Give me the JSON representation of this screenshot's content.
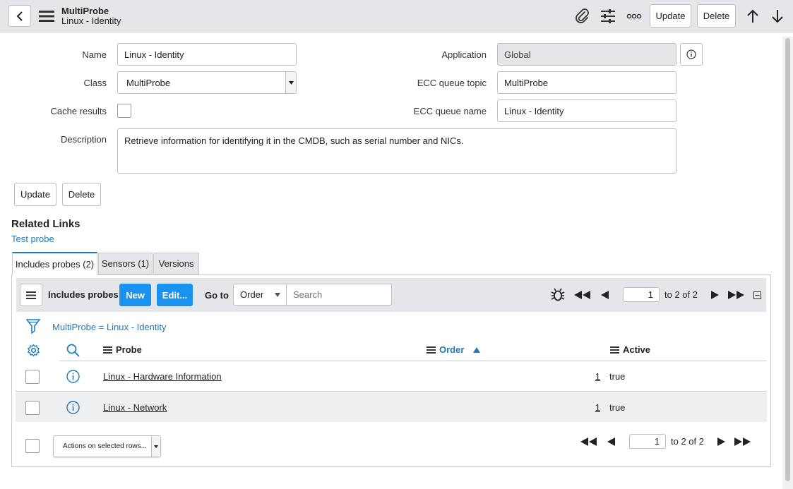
{
  "header": {
    "title": "MultiProbe",
    "subtitle": "Linux - Identity",
    "update_label": "Update",
    "delete_label": "Delete"
  },
  "form": {
    "name_label": "Name",
    "name_value": "Linux - Identity",
    "class_label": "Class",
    "class_value": "MultiProbe",
    "cache_label": "Cache results",
    "description_label": "Description",
    "description_value": "Retrieve information for identifying it in the CMDB, such as serial number and NICs.",
    "application_label": "Application",
    "application_value": "Global",
    "ecc_topic_label": "ECC queue topic",
    "ecc_topic_value": "MultiProbe",
    "ecc_name_label": "ECC queue name",
    "ecc_name_value": "Linux - Identity",
    "update_label": "Update",
    "delete_label": "Delete"
  },
  "related": {
    "title": "Related Links",
    "link": "Test probe"
  },
  "tabs": [
    {
      "label": "Includes probes (2)"
    },
    {
      "label": "Sensors (1)"
    },
    {
      "label": "Versions"
    }
  ],
  "list": {
    "title": "Includes probes",
    "new_label": "New",
    "edit_label": "Edit...",
    "goto_label": "Go to",
    "goto_field": "Order",
    "search_placeholder": "Search",
    "page_value": "1",
    "page_total": "to 2 of 2",
    "filter_text": "MultiProbe = Linux - Identity",
    "columns": {
      "probe": "Probe",
      "order": "Order",
      "active": "Active"
    },
    "rows": [
      {
        "probe": "Linux - Hardware Information",
        "order": "1",
        "active": "true"
      },
      {
        "probe": "Linux - Network",
        "order": "1",
        "active": "true"
      }
    ],
    "actions_label": "Actions on selected rows...",
    "bottom_page_value": "1",
    "bottom_page_total": "to 2 of 2"
  },
  "colors": {
    "accent": "#1f7ac0",
    "button_blue": "#1992f0"
  }
}
